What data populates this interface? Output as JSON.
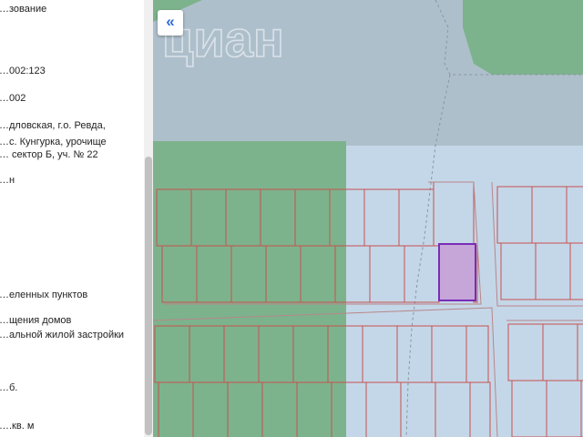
{
  "info_panel": {
    "lines": [
      "…зование",
      "…002:123",
      "…002",
      "…дловская, г.о. Ревда,",
      "…с. Кунгурка, урочище",
      "… сектор Б, уч. № 22",
      "…н",
      "…еленных пунктов",
      "…щения домов",
      "…альной жилой застройки",
      "…б.",
      "….кв. м"
    ]
  },
  "map": {
    "collapse_button_label": "«",
    "watermark": "циан",
    "colors": {
      "forest": "#7cb38c",
      "forest_dark": "#6aa680",
      "water": "#aebfcc",
      "land": "#c4d7e8",
      "parcel_border": "#c9524f",
      "selected_fill": "#c6a6d8",
      "selected_border": "#7a2bb8",
      "road_outline": "#b8868a"
    }
  }
}
